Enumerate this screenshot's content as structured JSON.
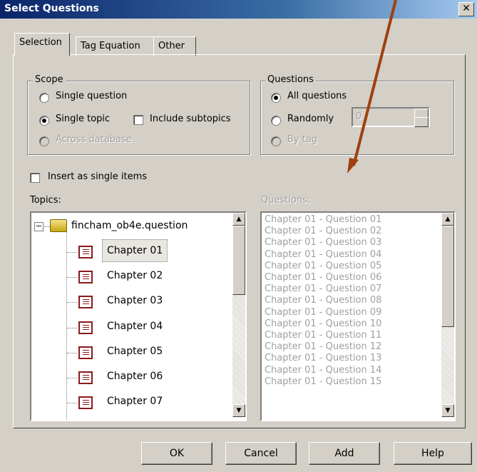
{
  "window": {
    "title": "Select Questions",
    "close_glyph": "✕"
  },
  "tabs": [
    {
      "label": "Selection"
    },
    {
      "label": "Tag Equation"
    },
    {
      "label": "Other"
    }
  ],
  "scope": {
    "legend": "Scope",
    "single_question": "Single question",
    "single_topic": "Single topic",
    "include_subtopics": "Include subtopics",
    "across_database": "Across database",
    "selected": "single_topic"
  },
  "questions_group": {
    "legend": "Questions",
    "all_questions": "All questions",
    "randomly": "Randomly",
    "by_tag": "By tag",
    "random_count": "0",
    "selected": "all_questions"
  },
  "insert_single_items": "Insert as single items",
  "topics": {
    "label": "Topics:",
    "root": "fincham_ob4e.question",
    "items": [
      "Chapter 01",
      "Chapter 02",
      "Chapter 03",
      "Chapter 04",
      "Chapter 05",
      "Chapter 06",
      "Chapter 07"
    ],
    "selected": "Chapter 01"
  },
  "question_list": {
    "label": "Questions:",
    "items": [
      "Chapter 01 - Question 01",
      "Chapter 01 - Question 02",
      "Chapter 01 - Question 03",
      "Chapter 01 - Question 04",
      "Chapter 01 - Question 05",
      "Chapter 01 - Question 06",
      "Chapter 01 - Question 07",
      "Chapter 01 - Question 08",
      "Chapter 01 - Question 09",
      "Chapter 01 - Question 10",
      "Chapter 01 - Question 11",
      "Chapter 01 - Question 12",
      "Chapter 01 - Question 13",
      "Chapter 01 - Question 14",
      "Chapter 01 - Question 15"
    ]
  },
  "buttons": {
    "ok": "OK",
    "cancel": "Cancel",
    "add": "Add",
    "help": "Help"
  },
  "colors": {
    "title_bar": "#0a246a",
    "annotation_arrow": "#a0400e",
    "dialog_bg": "#d4d0c8"
  }
}
